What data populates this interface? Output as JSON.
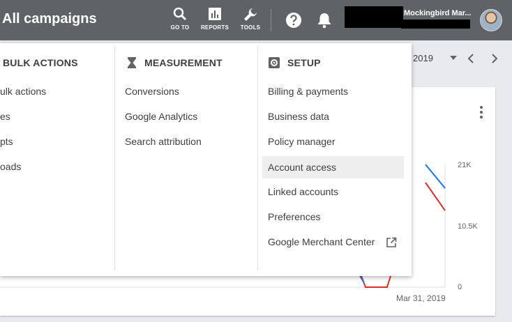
{
  "header": {
    "title": "All campaigns",
    "goto_label": "GO TO",
    "reports_label": "REPORTS",
    "tools_label": "TOOLS",
    "account_name": "Mockingbird Mar..."
  },
  "background": {
    "date_range": "2019",
    "axis_ticks": [
      "21K",
      "10.5K",
      "0"
    ],
    "x_label": "Mar 31, 2019",
    "colors": {
      "series_blue": "#1a73e8",
      "series_red": "#d93025"
    }
  },
  "menu": {
    "bulk_actions": {
      "heading": "BULK ACTIONS",
      "items": [
        "ulk actions",
        "es",
        "pts",
        "oads"
      ]
    },
    "measurement": {
      "heading": "MEASUREMENT",
      "items": [
        "Conversions",
        "Google Analytics",
        "Search attribution"
      ]
    },
    "setup": {
      "heading": "SETUP",
      "items": [
        "Billing & payments",
        "Business data",
        "Policy manager",
        "Account access",
        "Linked accounts",
        "Preferences",
        "Google Merchant Center"
      ]
    }
  }
}
